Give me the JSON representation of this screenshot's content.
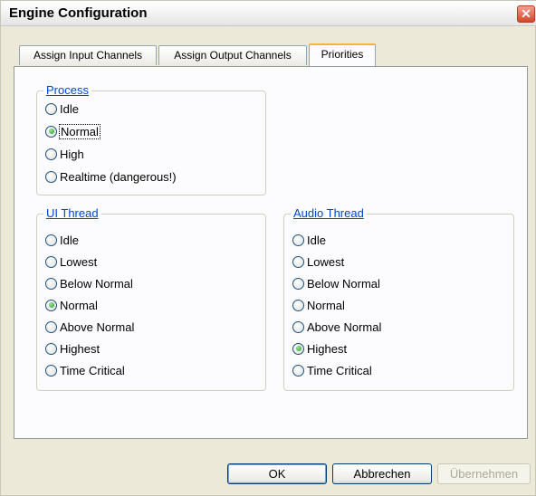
{
  "window": {
    "title": "Engine Configuration",
    "close_label": "✕"
  },
  "tabs": [
    {
      "label": "Assign Input Channels",
      "active": false
    },
    {
      "label": "Assign Output Channels",
      "active": false
    },
    {
      "label": "Priorities",
      "active": true
    }
  ],
  "process": {
    "title": "Process",
    "options": [
      {
        "label": "Idle",
        "checked": false
      },
      {
        "label": "Normal",
        "checked": true
      },
      {
        "label": "High",
        "checked": false
      },
      {
        "label": "Realtime (dangerous!)",
        "checked": false
      }
    ]
  },
  "ui_thread": {
    "title": "UI Thread",
    "options": [
      {
        "label": "Idle",
        "checked": false
      },
      {
        "label": "Lowest",
        "checked": false
      },
      {
        "label": "Below Normal",
        "checked": false
      },
      {
        "label": "Normal",
        "checked": true
      },
      {
        "label": "Above Normal",
        "checked": false
      },
      {
        "label": "Highest",
        "checked": false
      },
      {
        "label": "Time Critical",
        "checked": false
      }
    ]
  },
  "audio_thread": {
    "title": "Audio Thread",
    "options": [
      {
        "label": "Idle",
        "checked": false
      },
      {
        "label": "Lowest",
        "checked": false
      },
      {
        "label": "Below Normal",
        "checked": false
      },
      {
        "label": "Normal",
        "checked": false
      },
      {
        "label": "Above Normal",
        "checked": false
      },
      {
        "label": "Highest",
        "checked": true
      },
      {
        "label": "Time Critical",
        "checked": false
      }
    ]
  },
  "buttons": {
    "ok": "OK",
    "cancel": "Abbrechen",
    "apply": "Übernehmen"
  },
  "colors": {
    "group_title": "#0046d5",
    "active_tab_accent": "#f5b43f",
    "close_button": "#d4452a",
    "radio_checked": "#21a121"
  }
}
